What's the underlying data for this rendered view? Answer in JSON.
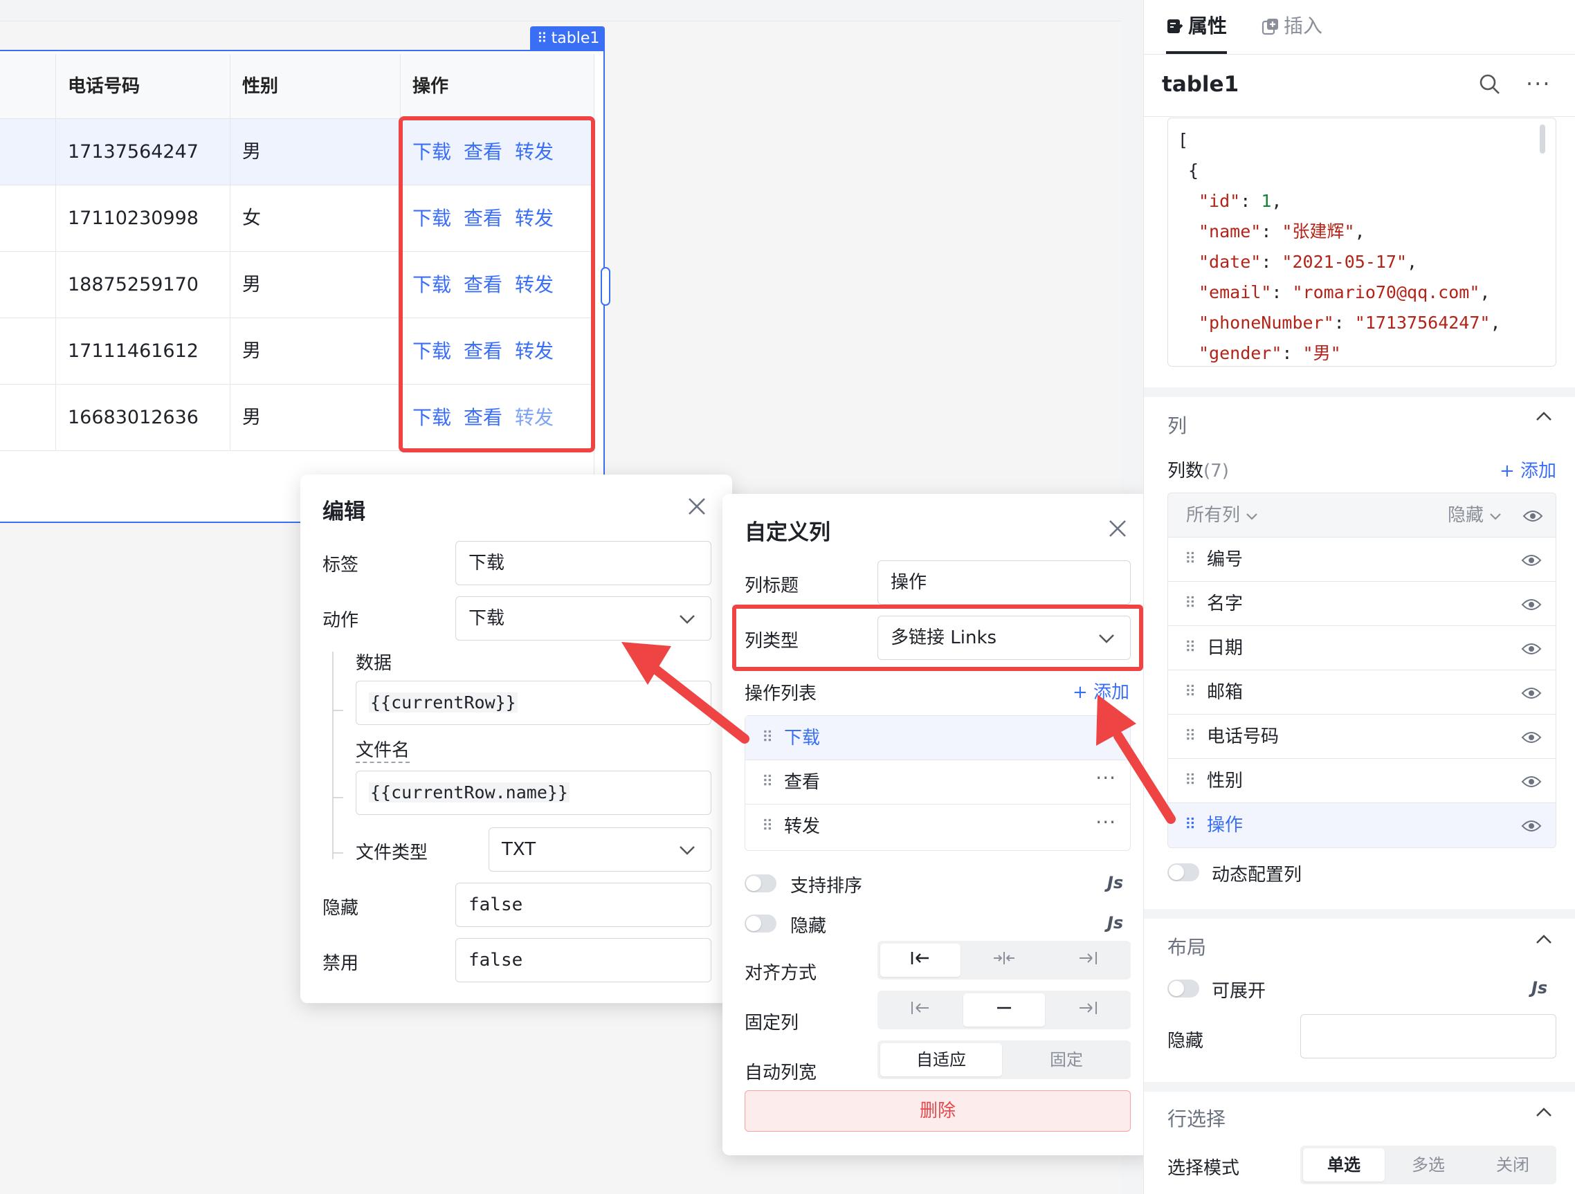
{
  "table": {
    "tag": "table1",
    "columns": [
      "电话号码",
      "性别",
      "操作"
    ],
    "rows": [
      {
        "phone": "17137564247",
        "gender": "男"
      },
      {
        "phone": "17110230998",
        "gender": "女"
      },
      {
        "phone": "18875259170",
        "gender": "男"
      },
      {
        "phone": "17111461612",
        "gender": "男"
      },
      {
        "phone": "16683012636",
        "gender": "男"
      }
    ],
    "actions": [
      "下载",
      "查看",
      "转发"
    ]
  },
  "edit_panel": {
    "title": "编辑",
    "label_label": "标签",
    "label_value": "下载",
    "action_label": "动作",
    "action_value": "下载",
    "data_label": "数据",
    "data_value": "{{currentRow}}",
    "filename_label": "文件名",
    "filename_value": "{{currentRow.name}}",
    "filetype_label": "文件类型",
    "filetype_value": "TXT",
    "hidden_label": "隐藏",
    "hidden_value": "false",
    "disabled_label": "禁用",
    "disabled_value": "false"
  },
  "col_panel": {
    "title": "自定义列",
    "col_title_label": "列标题",
    "col_title_value": "操作",
    "col_type_label": "列类型",
    "col_type_value": "多链接 Links",
    "action_list_label": "操作列表",
    "add_label": "+ 添加",
    "actions": [
      "下载",
      "查看",
      "转发"
    ],
    "sortable_label": "支持排序",
    "hidden_label": "隐藏",
    "js_label": "Js",
    "align_label": "对齐方式",
    "fixed_label": "固定列",
    "autowidth_label": "自动列宽",
    "autowidth_options": [
      "自适应",
      "固定"
    ],
    "delete_label": "删除"
  },
  "sidebar": {
    "tab_props": "属性",
    "tab_insert": "插入",
    "component_name": "table1",
    "json_lines": [
      {
        "t": "["
      },
      {
        "t": " {"
      },
      {
        "k": "\"id\"",
        "v": "1",
        "num": true
      },
      {
        "k": "\"name\"",
        "v": "\"张建辉\""
      },
      {
        "k": "\"date\"",
        "v": "\"2021-05-17\""
      },
      {
        "k": "\"email\"",
        "v": "\"romario70@qq.com\""
      },
      {
        "k": "\"phoneNumber\"",
        "v": "\"17137564247\""
      },
      {
        "k": "\"gender\"",
        "v": "\"男\"",
        "last": true
      }
    ],
    "section_columns": "列",
    "col_count_label": "列数",
    "col_count": "(7)",
    "add_label": "+ 添加",
    "all_cols_label": "所有列",
    "hide_label": "隐藏",
    "columns": [
      "编号",
      "名字",
      "日期",
      "邮箱",
      "电话号码",
      "性别",
      "操作"
    ],
    "dynamic_cols_label": "动态配置列",
    "section_layout": "布局",
    "expandable_label": "可展开",
    "js_label": "Js",
    "hidden_label": "隐藏",
    "section_row_select": "行选择",
    "select_mode_label": "选择模式",
    "select_modes": [
      "单选",
      "多选",
      "关闭"
    ]
  },
  "colors": {
    "accent": "#3a6ff5",
    "highlight_red": "#ef4444",
    "danger_text": "#e5484d"
  }
}
